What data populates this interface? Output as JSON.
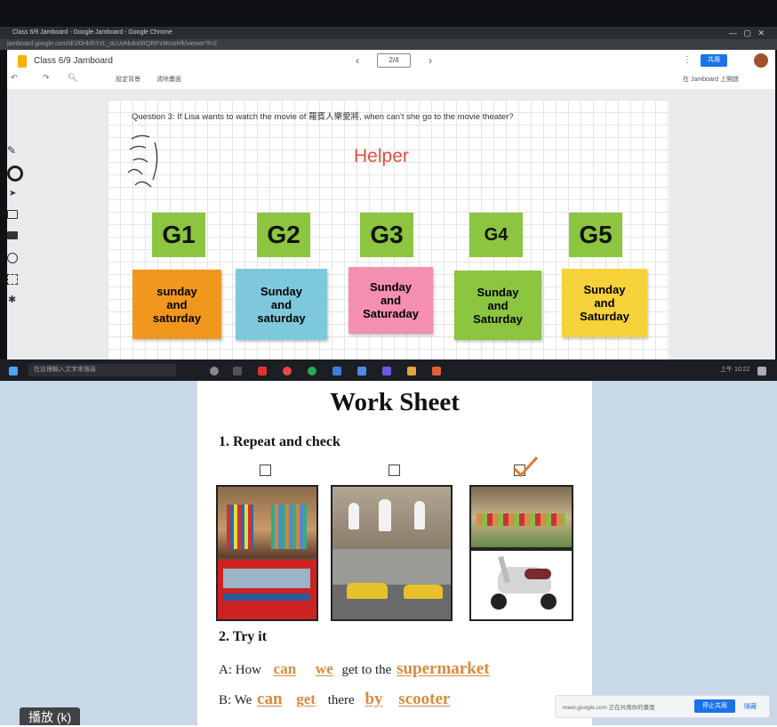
{
  "browser": {
    "title": "Class 6/9 Jamboard - Google Jamboard - Google Chrome",
    "url": "jamboard.google.com/d/1f0HkfhYzL_oLUohkdo0RQRPz9Kvohfk/viewer?f=2"
  },
  "jamboard": {
    "doc_title": "Class 6/9 Jamboard",
    "frame_indicator": "2/4",
    "menu_clear": "設定背景",
    "menu_reset": "清除畫面",
    "share_label": "共用",
    "header_right": "在 Jamboard 上開啟",
    "question": "Question 3: If Lisa wants to watch the movie of 羅賓人樂愛將, when can't she go to the movie theater?",
    "helper": "Helper",
    "groups": [
      "G1",
      "G2",
      "G3",
      "G4",
      "G5"
    ],
    "notes": [
      {
        "text": "sunday\nand\nsaturday",
        "color": "#f2971e"
      },
      {
        "text": "Sunday\nand\nsaturday",
        "color": "#7ec8dc"
      },
      {
        "text": "Sunday\nand\nSaturaday",
        "color": "#f48fb1"
      },
      {
        "text": "Sunday\nand\nSaturday",
        "color": "#8cc53f"
      },
      {
        "text": "Sunday\nand\nSaturday",
        "color": "#f6d23a"
      }
    ]
  },
  "taskbar": {
    "search_placeholder": "在這裡輸入文字來搜尋",
    "clock": "上午 10:22"
  },
  "worksheet": {
    "title": "Work Sheet",
    "section1": "1. Repeat and check",
    "section2": "2. Try it",
    "a_prefix": "A: How",
    "a_ans1": "can",
    "a_ans2": "we",
    "a_mid": "get to the",
    "a_ans3": "supermarket",
    "b_prefix": "B: We",
    "b_ans1": "can",
    "b_ans2": "get",
    "b_mid": "there",
    "b_ans3": "by",
    "b_ans4": "scooter"
  },
  "meet_bar": {
    "text": "meet.google.com 正在共用你的畫面",
    "stop_label": "停止共用",
    "hide_label": "隱藏"
  },
  "play_label": "播放 (k)",
  "colors": {
    "jam_green": "#8cc53f",
    "helper_red": "#e0503c",
    "answer_orange": "#d98a3e",
    "meet_blue": "#1a73e8"
  }
}
